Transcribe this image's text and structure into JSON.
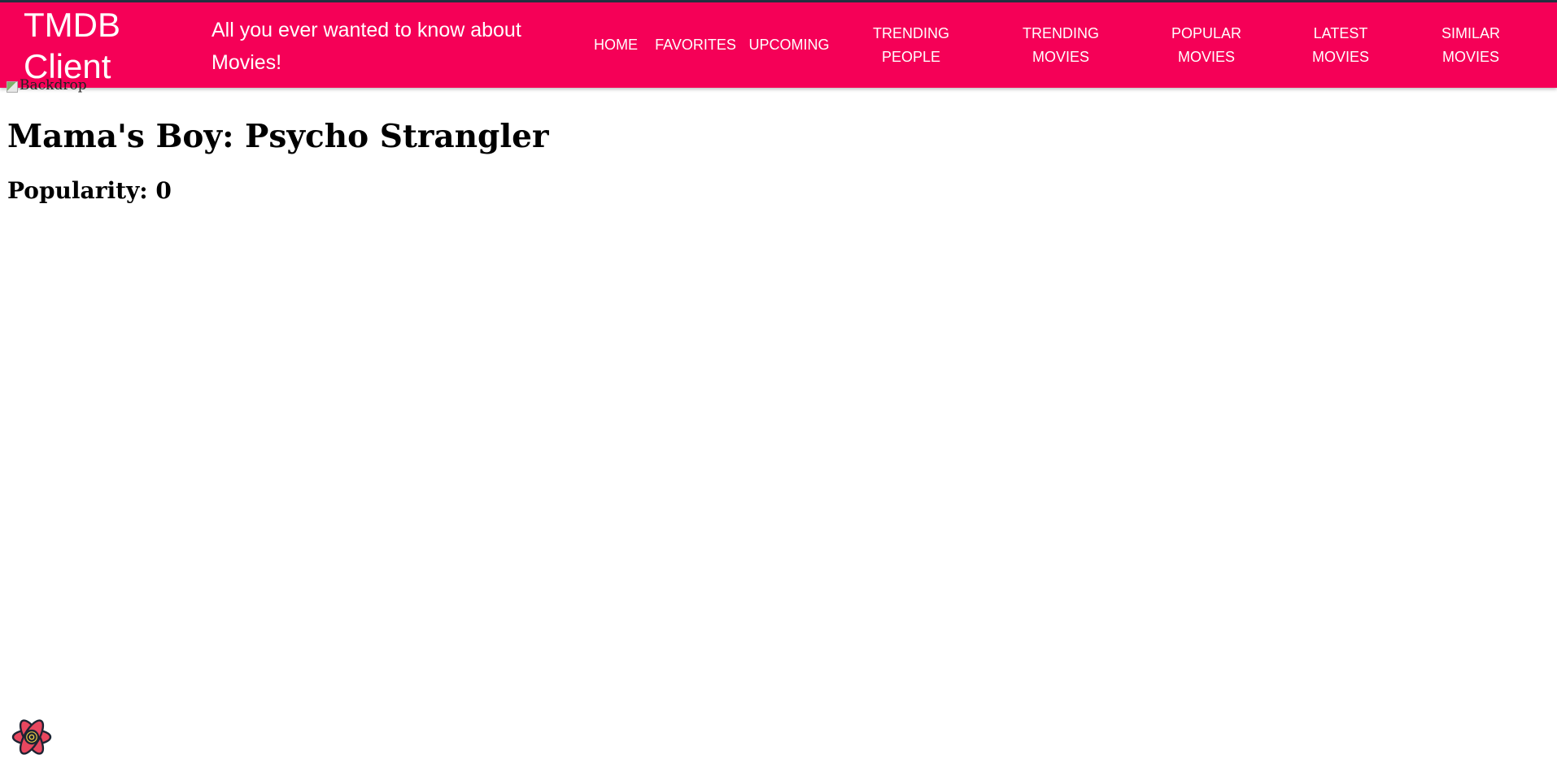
{
  "header": {
    "brand": "TMDB Client",
    "tagline": "All you ever wanted to know about Movies!",
    "nav": [
      {
        "lines": [
          "HOME"
        ]
      },
      {
        "lines": [
          "FAVORITES"
        ]
      },
      {
        "lines": [
          "UPCOMING"
        ]
      },
      {
        "lines": [
          "TRENDING",
          "PEOPLE"
        ]
      },
      {
        "lines": [
          "TRENDING",
          "MOVIES"
        ]
      },
      {
        "lines": [
          "POPULAR",
          "MOVIES"
        ]
      },
      {
        "lines": [
          "LATEST",
          "MOVIES"
        ]
      },
      {
        "lines": [
          "SIMILAR",
          "MOVIES"
        ]
      }
    ]
  },
  "main": {
    "backdrop_alt": "Backdrop",
    "title": "Mama's Boy: Psycho Strangler",
    "popularity": "Popularity: 0"
  },
  "floating": {
    "icon": "react-logo-icon"
  },
  "colors": {
    "appbar": "#f50057",
    "top_strip": "#243040",
    "appbar_text": "#ffffff",
    "react_logo_fill": "#e8475f",
    "react_logo_core": "#f5d547"
  }
}
